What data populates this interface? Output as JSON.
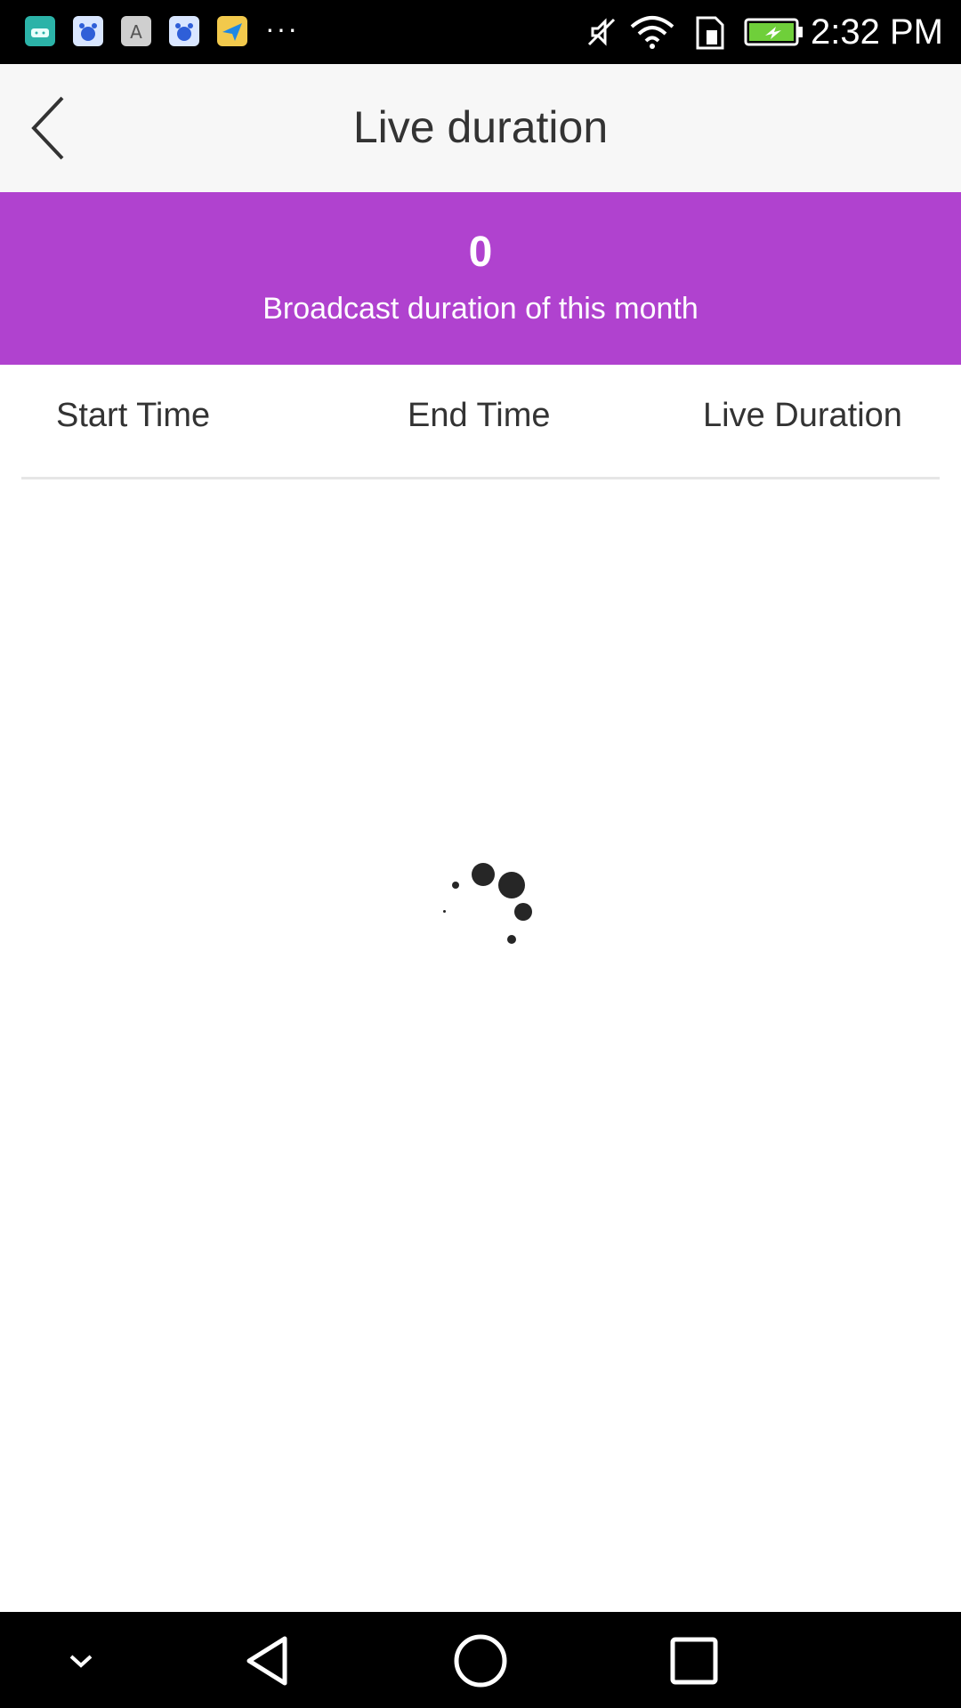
{
  "status_bar": {
    "time": "2:32 PM",
    "notification_icons": [
      "android-icon",
      "baidu-icon",
      "text-a-icon",
      "baidu-icon",
      "maps-icon"
    ],
    "more": "···"
  },
  "header": {
    "title": "Live duration"
  },
  "summary": {
    "value": "0",
    "label": "Broadcast duration of this month",
    "accent_color": "#b042cf"
  },
  "table": {
    "columns": [
      "Start Time",
      "End Time",
      "Live Duration"
    ],
    "rows": []
  },
  "loading": true
}
